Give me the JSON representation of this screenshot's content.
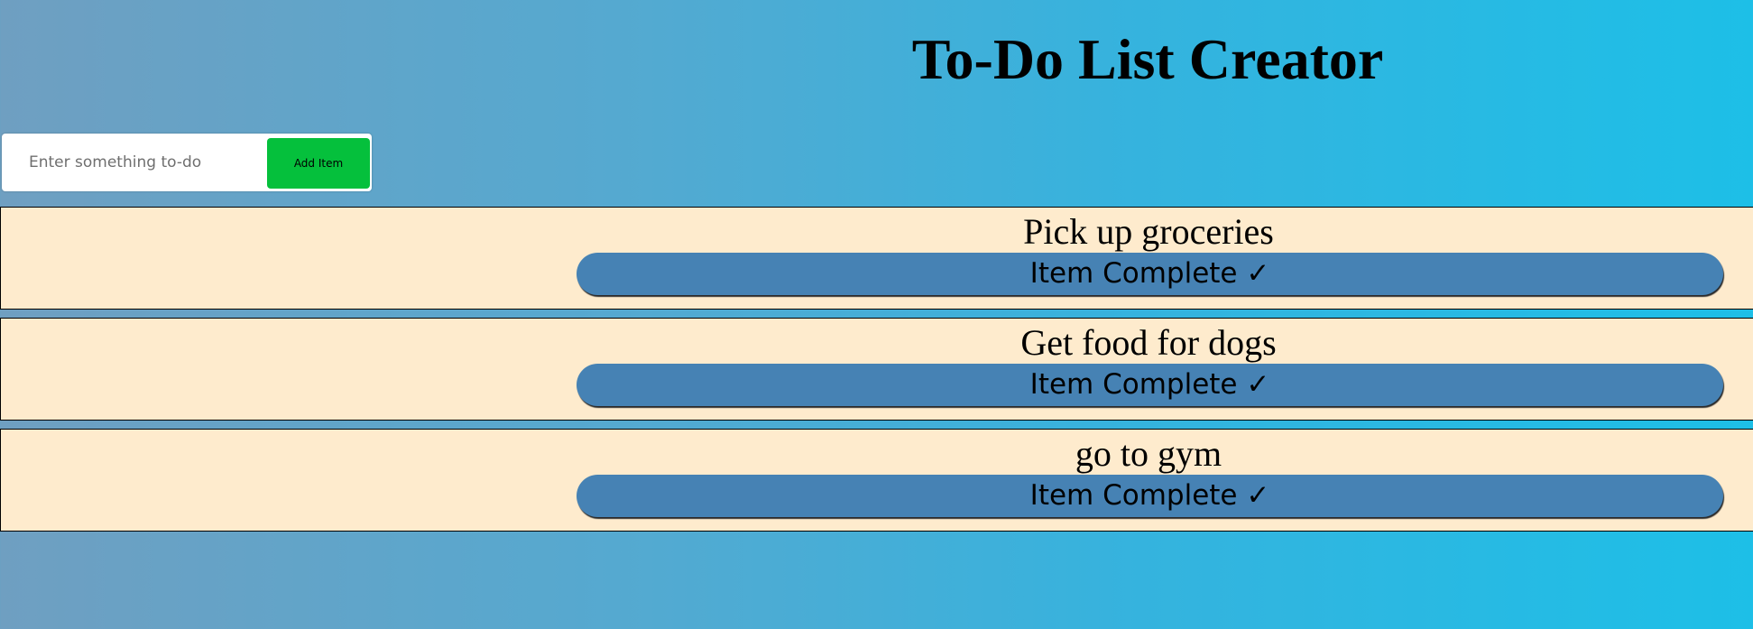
{
  "header": {
    "title": "To-Do List Creator"
  },
  "entry": {
    "placeholder": "Enter something to-do",
    "value": "",
    "add_label": "Add Item"
  },
  "todos": [
    {
      "text": "Pick up groceries",
      "complete_label": "Item Complete ✓"
    },
    {
      "text": "Get food for dogs",
      "complete_label": "Item Complete ✓"
    },
    {
      "text": "go to gym",
      "complete_label": "Item Complete ✓"
    }
  ],
  "colors": {
    "item_background": "#feebcd",
    "complete_button": "#4682b4",
    "add_button": "#05c03c",
    "gradient_left": "#6f9fc1",
    "gradient_right": "#1dbfe7"
  }
}
